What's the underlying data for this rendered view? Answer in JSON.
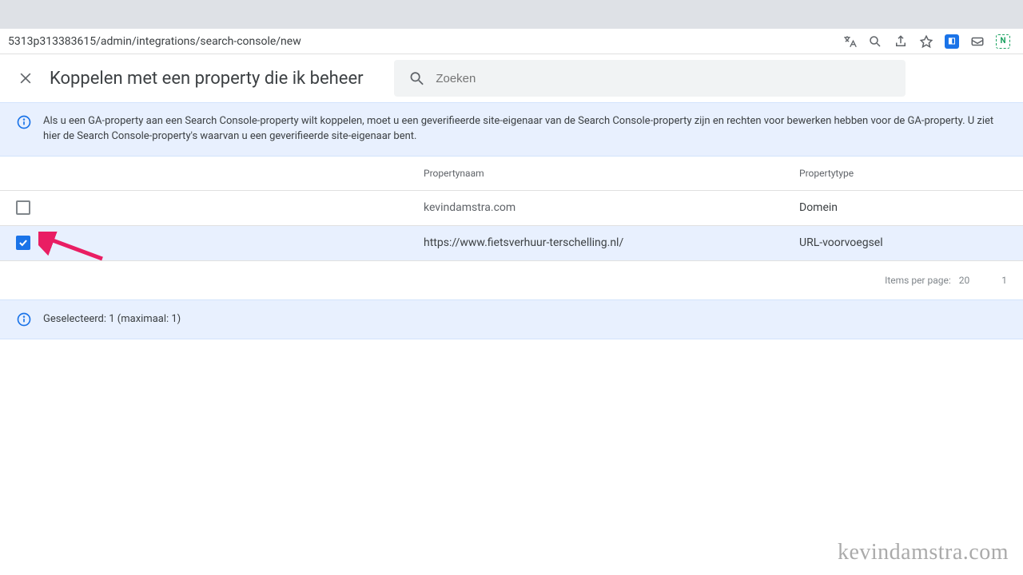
{
  "browser": {
    "url": "5313p313383615/admin/integrations/search-console/new"
  },
  "header": {
    "title": "Koppelen met een property die ik beheer"
  },
  "search": {
    "placeholder": "Zoeken"
  },
  "info": {
    "text": "Als u een GA-property aan een Search Console-property wilt koppelen, moet u een geverifieerde site-eigenaar van de Search Console-property zijn en rechten voor bewerken hebben voor de GA-property. U ziet hier de Search Console-property's waarvan u een geverifieerde site-eigenaar bent."
  },
  "table": {
    "colName": "Propertynaam",
    "colType": "Propertytype",
    "rows": [
      {
        "name": "kevindamstra.com",
        "type": "Domein",
        "checked": false
      },
      {
        "name": "https://www.fietsverhuur-terschelling.nl/",
        "type": "URL-voorvoegsel",
        "checked": true
      }
    ]
  },
  "pager": {
    "label": "Items per page:",
    "count": "20",
    "range": "1"
  },
  "selection": {
    "text": "Geselecteerd: 1 (maximaal: 1)"
  },
  "watermark": "kevindamstra.com"
}
